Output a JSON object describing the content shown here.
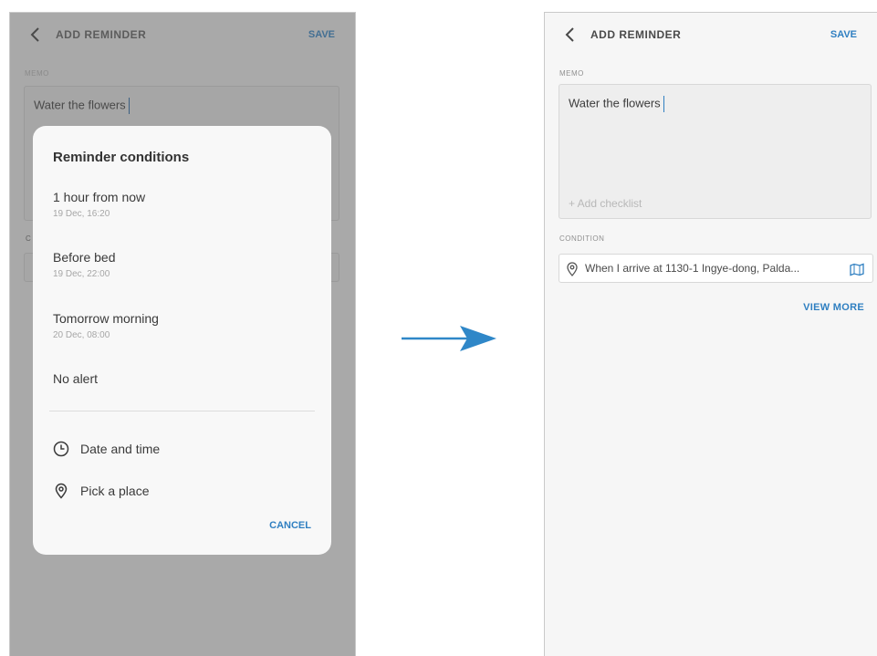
{
  "before_screen": {
    "title": "ADD REMINDER",
    "save_label": "SAVE",
    "memo_label": "MEMO",
    "memo_text": "Water the flowers",
    "condition_label_partial": "C",
    "dialog": {
      "title": "Reminder conditions",
      "options": [
        {
          "label": "1 hour from now",
          "sub": "19 Dec, 16:20"
        },
        {
          "label": "Before bed",
          "sub": "19 Dec, 22:00"
        },
        {
          "label": "Tomorrow morning",
          "sub": "20 Dec, 08:00"
        },
        {
          "label": "No alert",
          "sub": ""
        }
      ],
      "date_time_label": "Date and time",
      "pick_place_label": "Pick a place",
      "cancel_label": "CANCEL"
    }
  },
  "after_screen": {
    "title": "ADD REMINDER",
    "save_label": "SAVE",
    "memo_label": "MEMO",
    "memo_text": "Water the flowers",
    "add_checklist": "+ Add checklist",
    "condition_label": "CONDITION",
    "condition_text": "When I arrive at 1130-1 Ingye-dong, Palda...",
    "view_more_label": "VIEW MORE"
  },
  "icons": {
    "back": "chevron-left-icon",
    "clock": "clock-icon",
    "location": "location-pin-icon",
    "map": "map-icon",
    "arrow": "right-arrow-icon"
  },
  "colors": {
    "accent": "#2f7fc1",
    "dim_overlay": "#a9a9a9",
    "dialog_bg": "#f8f8f8"
  }
}
